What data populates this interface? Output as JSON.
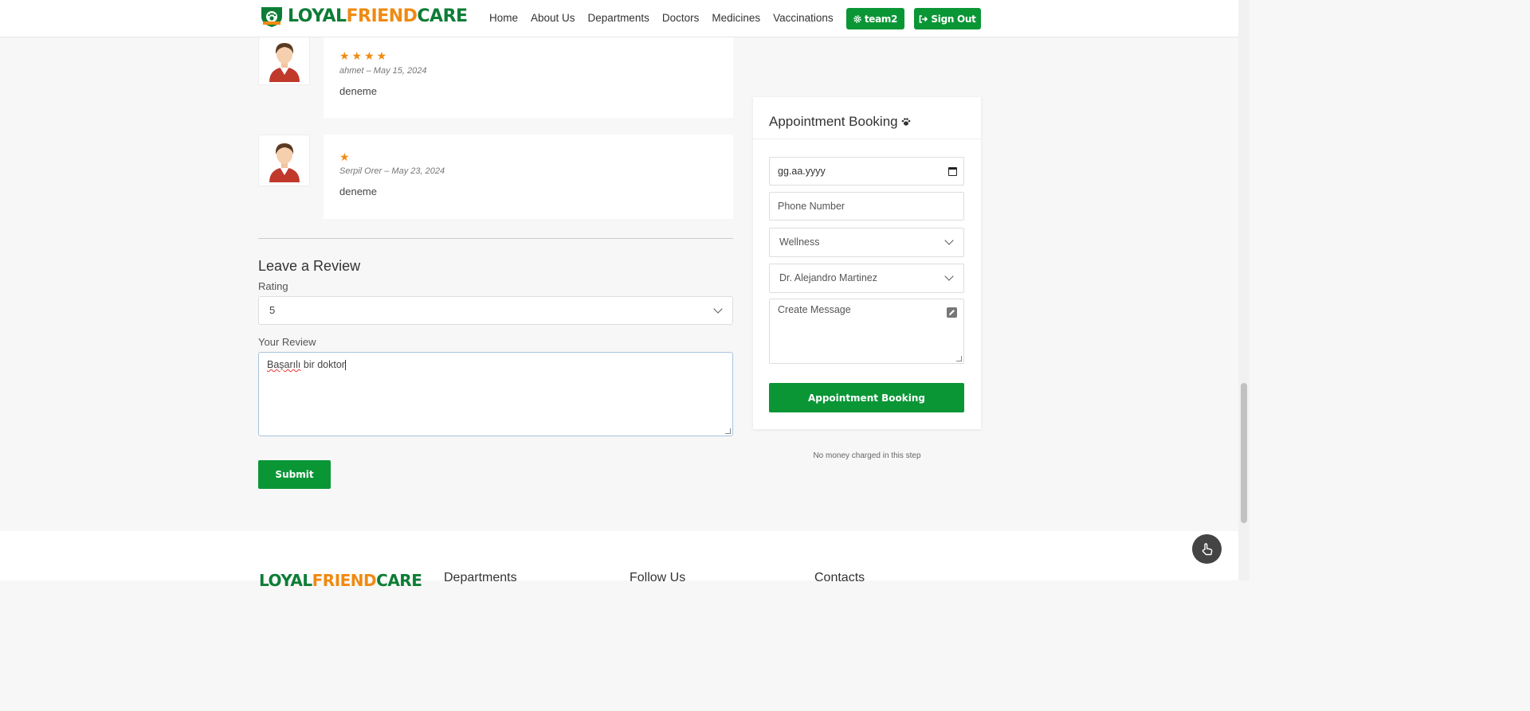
{
  "header": {
    "logo_part1": "LOYAL",
    "logo_part2": "FRIEND",
    "logo_part3": "CARE",
    "nav": [
      "Home",
      "About Us",
      "Departments",
      "Doctors",
      "Medicines",
      "Vaccinations"
    ],
    "team_button": "team2",
    "signout_button": "Sign Out"
  },
  "reviews": [
    {
      "stars": "★★★★",
      "author_date": "ahmet – May 15, 2024",
      "text": "deneme"
    },
    {
      "stars": "★",
      "author_date": "Serpil Orer – May 23, 2024",
      "text": "deneme"
    }
  ],
  "review_form": {
    "title": "Leave a Review",
    "rating_label": "Rating",
    "rating_value": "5",
    "review_label": "Your Review",
    "review_word1": "Başarılı",
    "review_rest": " bir doktor",
    "submit": "Submit"
  },
  "appointment": {
    "title": "Appointment Booking",
    "date_placeholder": "gg.aa.yyyy",
    "phone_placeholder": "Phone Number",
    "department": "Wellness",
    "doctor": "Dr. Alejandro Martinez",
    "message_placeholder": "Create Message",
    "button": "Appointment Booking",
    "note": "No money charged in this step"
  },
  "footer": {
    "headings": [
      "Departments",
      "Follow Us",
      "Contacts"
    ]
  },
  "colors": {
    "brand_green": "#0b9636",
    "brand_orange": "#f08a11"
  }
}
